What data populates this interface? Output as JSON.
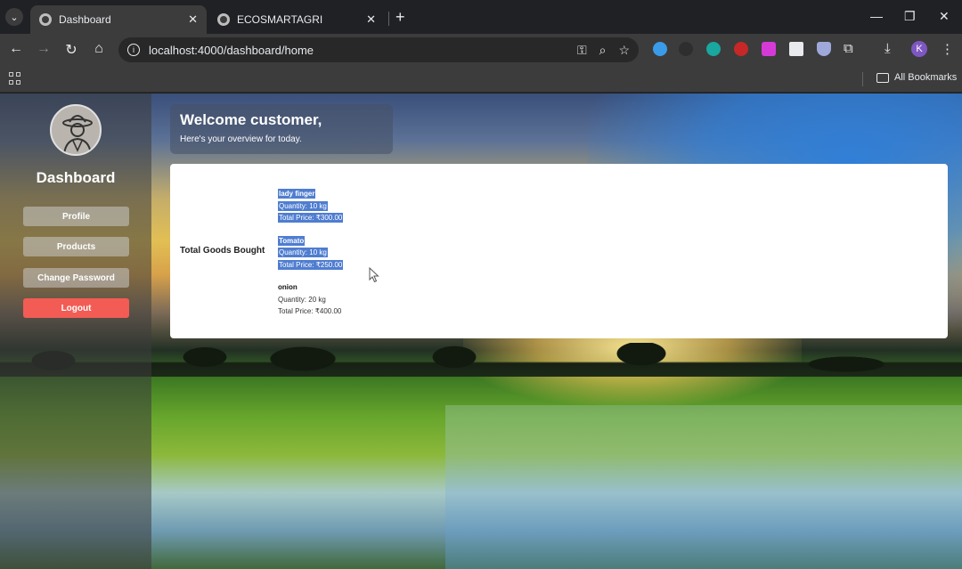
{
  "browser": {
    "tabs": [
      {
        "title": "Dashboard",
        "active": true
      },
      {
        "title": "ECOSMARTAGRI",
        "active": false
      }
    ],
    "url": "localhost:4000/dashboard/home",
    "bookmarks_label": "All Bookmarks",
    "profile_initial": "K",
    "icons": {
      "tab_list": "chevron-down-icon",
      "new_tab": "plus-icon",
      "back": "arrow-left-icon",
      "forward": "arrow-right-icon",
      "reload": "reload-icon",
      "home": "home-icon",
      "site_info": "info-icon",
      "password_key": "key-icon",
      "zoom": "zoom-icon",
      "bookmark_star": "star-icon",
      "extensions": "puzzle-icon",
      "downloads": "download-icon",
      "menu": "kebab-menu-icon"
    }
  },
  "sidebar": {
    "title": "Dashboard",
    "buttons": [
      {
        "label": "Profile"
      },
      {
        "label": "Products"
      },
      {
        "label": "Change Password"
      },
      {
        "label": "Logout"
      }
    ],
    "logout_color": "#f25c54"
  },
  "welcome": {
    "title": "Welcome customer,",
    "subtitle": "Here's your overview for today."
  },
  "goods": {
    "label": "Total Goods Bought",
    "items": [
      {
        "name": "lady finger",
        "quantity": "Quantity: 10 kg",
        "total": "Total Price: ₹300.00",
        "selected": true
      },
      {
        "name": "Tomato",
        "quantity": "Quantity: 10 kg",
        "total": "Total Price: ₹250.00",
        "selected": true
      },
      {
        "name": "onion",
        "quantity": "Quantity: 20 kg",
        "total": "Total Price: ₹400.00",
        "selected": false
      }
    ],
    "selection_color": "#4f7dd0"
  }
}
